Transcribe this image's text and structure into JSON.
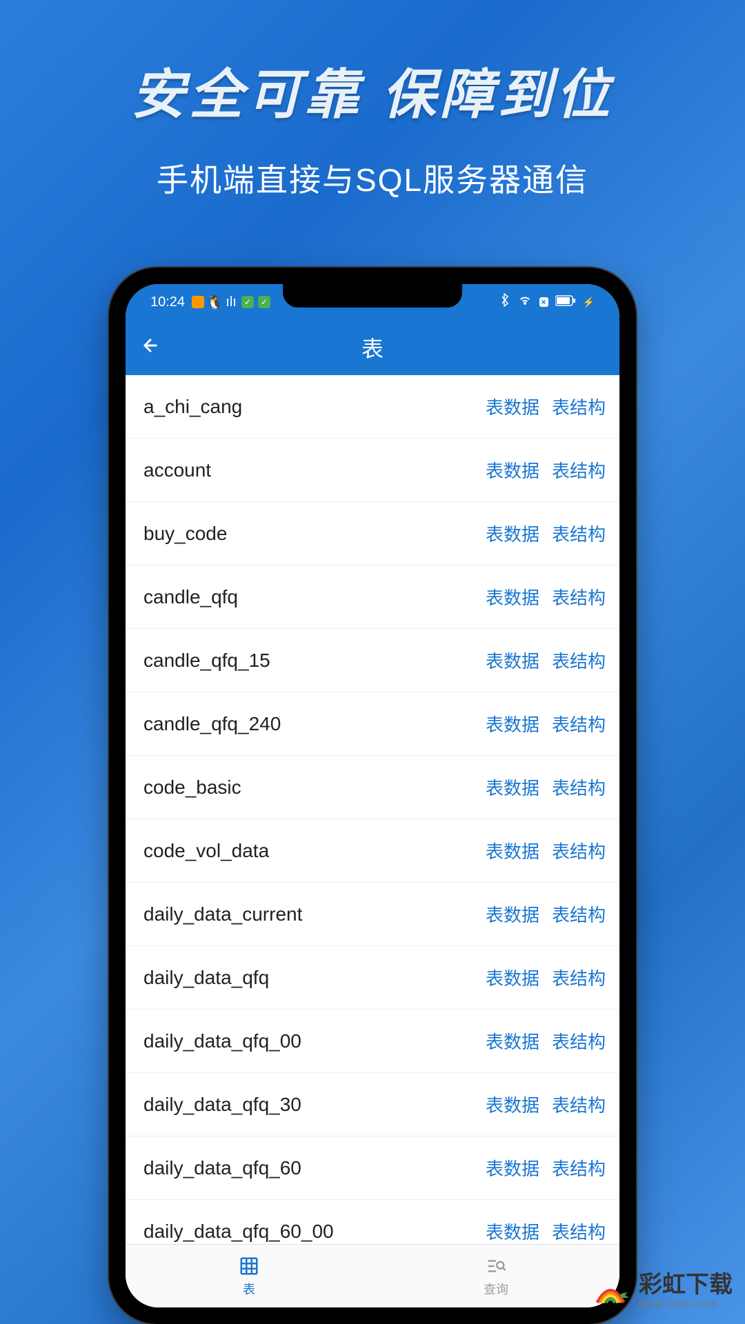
{
  "promo": {
    "title": "安全可靠 保障到位",
    "subtitle": "手机端直接与SQL服务器通信"
  },
  "status": {
    "time": "10:24"
  },
  "header": {
    "title": "表"
  },
  "actions": {
    "data": "表数据",
    "schema": "表结构"
  },
  "tables": [
    {
      "name": "a_chi_cang"
    },
    {
      "name": "account"
    },
    {
      "name": "buy_code"
    },
    {
      "name": "candle_qfq"
    },
    {
      "name": "candle_qfq_15"
    },
    {
      "name": "candle_qfq_240"
    },
    {
      "name": "code_basic"
    },
    {
      "name": "code_vol_data"
    },
    {
      "name": "daily_data_current"
    },
    {
      "name": "daily_data_qfq"
    },
    {
      "name": "daily_data_qfq_00"
    },
    {
      "name": "daily_data_qfq_30"
    },
    {
      "name": "daily_data_qfq_60"
    },
    {
      "name": "daily_data_qfq_60_00"
    }
  ],
  "nav": {
    "tables": "表",
    "query": "查询"
  },
  "watermark": {
    "cn": "彩虹下载",
    "en": "www.7hon.com"
  }
}
